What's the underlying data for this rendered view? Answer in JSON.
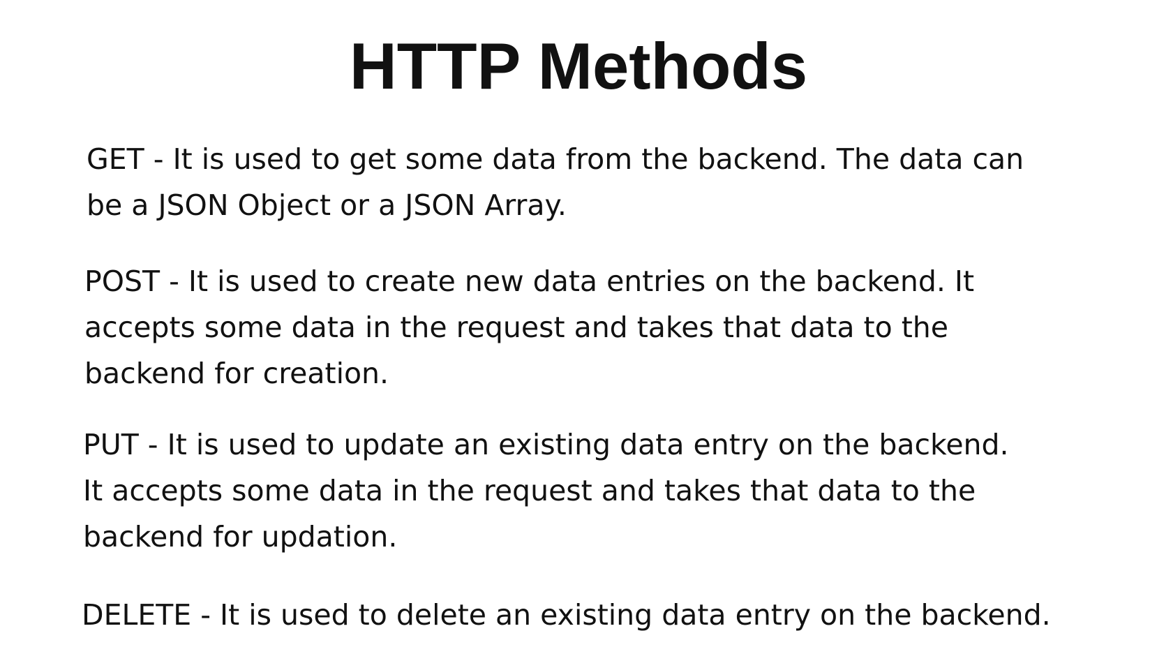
{
  "title": "HTTP Methods",
  "methods": [
    {
      "lines": [
        "GET - It is used to get some data from the backend. The data can",
        "be a JSON Object or a JSON Array."
      ]
    },
    {
      "lines": [
        "POST - It is used to create new data entries on the backend. It",
        "accepts some data in the request and takes that data to the",
        "backend for creation."
      ]
    },
    {
      "lines": [
        "PUT - It is used to update an existing data entry on the backend.",
        "It accepts some data in the request and takes that data to the",
        "backend for updation."
      ]
    },
    {
      "lines": [
        "DELETE - It is used to delete an existing data entry on the backend."
      ]
    }
  ]
}
